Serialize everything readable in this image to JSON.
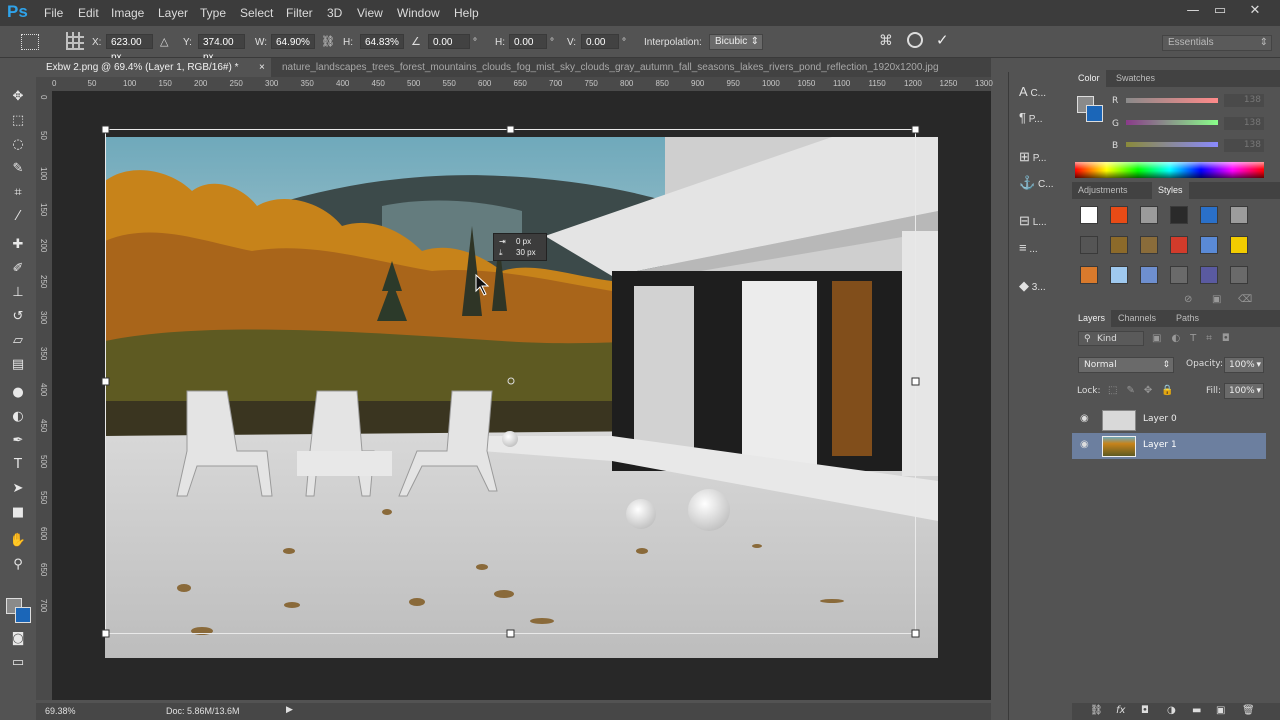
{
  "app": {
    "logo": "Ps"
  },
  "menu": [
    "File",
    "Edit",
    "Image",
    "Layer",
    "Type",
    "Select",
    "Filter",
    "3D",
    "View",
    "Window",
    "Help"
  ],
  "window_controls": {
    "minimize": "—",
    "maximize": "▭",
    "close": "✕"
  },
  "options": {
    "x_label": "X:",
    "x_value": "623.00 px",
    "y_label": "Y:",
    "y_value": "374.00 px",
    "w_label": "W:",
    "w_value": "64.90%",
    "h_label": "H:",
    "h_value": "64.83%",
    "angle_value": "0.00",
    "angle_unit": "°",
    "hskew_label": "H:",
    "hskew_value": "0.00",
    "hskew_unit": "°",
    "vskew_label": "V:",
    "vskew_value": "0.00",
    "vskew_unit": "°",
    "interp_label": "Interpolation:",
    "interp_value": "Bicubic",
    "workspace": "Essentials"
  },
  "tabs": [
    {
      "label": "Exbw 2.png @ 69.4% (Layer 1, RGB/16#) *",
      "close": "×",
      "active": true
    },
    {
      "label": "nature_landscapes_trees_forest_mountains_clouds_fog_mist_sky_clouds_gray_autumn_fall_seasons_lakes_rivers_pond_reflection_1920x1200.jpg",
      "active": false
    }
  ],
  "ruler_top": [
    "0",
    "50",
    "100",
    "150",
    "200",
    "250",
    "300",
    "350",
    "400",
    "450",
    "500",
    "550",
    "600",
    "650",
    "700",
    "750",
    "800",
    "850",
    "900",
    "950",
    "1000",
    "1050",
    "1100",
    "1150",
    "1200",
    "1250",
    "1300"
  ],
  "ruler_left": [
    "0",
    "50",
    "100",
    "150",
    "200",
    "250",
    "300",
    "350",
    "400",
    "450",
    "500",
    "550",
    "600",
    "650",
    "700"
  ],
  "tooltip": {
    "dx": "0 px",
    "dy": "30 px"
  },
  "status": {
    "zoom": "69.38%",
    "doc": "Doc: 5.86M/13.6M"
  },
  "mid_panel": [
    {
      "icon": "A",
      "label": "C..."
    },
    {
      "icon": "¶",
      "label": "P..."
    },
    {
      "icon": "⊞",
      "label": "P..."
    },
    {
      "icon": "⚓",
      "label": "C..."
    },
    {
      "icon": "⊟",
      "label": "L..."
    },
    {
      "icon": "≡",
      "label": "..."
    },
    {
      "icon": "◆",
      "label": "3..."
    }
  ],
  "color_panel": {
    "tabs": [
      "Color",
      "Swatches"
    ],
    "channels": [
      {
        "name": "R",
        "value": "138"
      },
      {
        "name": "G",
        "value": "138"
      },
      {
        "name": "B",
        "value": "138"
      }
    ],
    "fg_color": "#8a8a8a",
    "bg_color": "#1b66b8"
  },
  "styles_panel": {
    "tabs": [
      "Adjustments",
      "Styles"
    ],
    "swatches": [
      "#ffffff",
      "#e84b16",
      "#9b9b9b",
      "#2a2a2a",
      "#2a70c9",
      "#9c9c9c",
      "#555555",
      "#8c6a2a",
      "#8a6c3a",
      "#d23b2b",
      "#5a8ad6",
      "#f2cc00",
      "#d97a2c",
      "#9fc9ef",
      "#6e8fcf",
      "#6a6a6a",
      "#5a5aa0",
      "#6a6a6a"
    ]
  },
  "layers_panel": {
    "tabs": [
      "Layers",
      "Channels",
      "Paths"
    ],
    "kind": "Kind",
    "blend_mode": "Normal",
    "opacity_label": "Opacity:",
    "opacity_value": "100%",
    "lock_label": "Lock:",
    "fill_label": "Fill:",
    "fill_value": "100%",
    "layers": [
      {
        "name": "Layer 0",
        "selected": false
      },
      {
        "name": "Layer 1",
        "selected": true
      }
    ],
    "footer_icons": [
      "link-icon",
      "fx-icon",
      "mask-icon",
      "adjustment-icon",
      "group-icon",
      "new-layer-icon",
      "trash-icon"
    ]
  },
  "colors": {
    "accent_blue": "#2fa3ea",
    "selected_layer": "#6c7f9f"
  }
}
